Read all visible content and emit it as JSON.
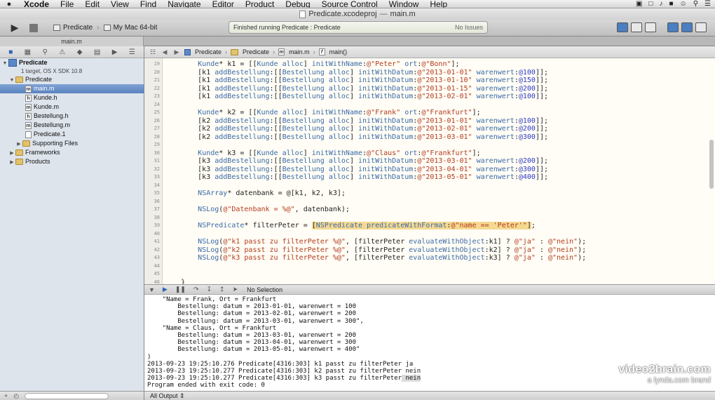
{
  "menubar": {
    "app": "Xcode",
    "items": [
      "File",
      "Edit",
      "View",
      "Find",
      "Navigate",
      "Editor",
      "Product",
      "Debug",
      "Source Control",
      "Window",
      "Help"
    ]
  },
  "window": {
    "title": "Predicate.xcodeproj",
    "separator": "—",
    "file": "main.m"
  },
  "toolbar": {
    "scheme": "Predicate",
    "destination": "My Mac 64-bit",
    "status_text": "Finished running Predicate : Predicate",
    "issues": "No Issues"
  },
  "tab": {
    "label": "main.m"
  },
  "jumpbar": {
    "crumbs": [
      "Predicate",
      "Predicate",
      "main.m",
      "main()"
    ]
  },
  "navigator": {
    "project": "Predicate",
    "project_sub": "1 target, OS X SDK 10.8",
    "items": [
      {
        "label": "Predicate",
        "type": "folder",
        "level": 1,
        "open": true
      },
      {
        "label": "main.m",
        "type": "file",
        "badge": "m",
        "level": 2,
        "selected": true
      },
      {
        "label": "Kunde.h",
        "type": "file",
        "badge": "h",
        "level": 2
      },
      {
        "label": "Kunde.m",
        "type": "file",
        "badge": "m",
        "level": 2
      },
      {
        "label": "Bestellung.h",
        "type": "file",
        "badge": "h",
        "level": 2
      },
      {
        "label": "Bestellung.m",
        "type": "file",
        "badge": "m",
        "level": 2
      },
      {
        "label": "Predicate.1",
        "type": "file",
        "badge": "",
        "level": 2
      },
      {
        "label": "Supporting Files",
        "type": "folder",
        "level": 2,
        "open": false
      },
      {
        "label": "Frameworks",
        "type": "folder",
        "level": 1,
        "open": false
      },
      {
        "label": "Products",
        "type": "folder",
        "level": 1,
        "open": false
      }
    ]
  },
  "editor": {
    "line_numbers": [
      "19",
      "20",
      "21",
      "22",
      "23",
      "24",
      "25",
      "26",
      "27",
      "28",
      "29",
      "30",
      "31",
      "32",
      "33",
      "34",
      "35",
      "36",
      "37",
      "38",
      "39",
      "40",
      "41",
      "42",
      "43",
      "44",
      "45",
      "46"
    ],
    "lines": [
      "        Kunde* k1 = [[Kunde alloc] initWithName:@\"Peter\" ort:@\"Bonn\"];",
      "        [k1 addBestellung:[[Bestellung alloc] initWithDatum:@\"2013-01-01\" warenwert:@100]];",
      "        [k1 addBestellung:[[Bestellung alloc] initWithDatum:@\"2013-01-10\" warenwert:@150]];",
      "        [k1 addBestellung:[[Bestellung alloc] initWithDatum:@\"2013-01-15\" warenwert:@200]];",
      "        [k1 addBestellung:[[Bestellung alloc] initWithDatum:@\"2013-02-01\" warenwert:@100]];",
      "",
      "        Kunde* k2 = [[Kunde alloc] initWithName:@\"Frank\" ort:@\"Frankfurt\"];",
      "        [k2 addBestellung:[[Bestellung alloc] initWithDatum:@\"2013-01-01\" warenwert:@100]];",
      "        [k2 addBestellung:[[Bestellung alloc] initWithDatum:@\"2013-02-01\" warenwert:@200]];",
      "        [k2 addBestellung:[[Bestellung alloc] initWithDatum:@\"2013-03-01\" warenwert:@300]];",
      "",
      "        Kunde* k3 = [[Kunde alloc] initWithName:@\"Claus\" ort:@\"Frankfurt\"];",
      "        [k3 addBestellung:[[Bestellung alloc] initWithDatum:@\"2013-03-01\" warenwert:@200]];",
      "        [k3 addBestellung:[[Bestellung alloc] initWithDatum:@\"2013-04-01\" warenwert:@300]];",
      "        [k3 addBestellung:[[Bestellung alloc] initWithDatum:@\"2013-05-01\" warenwert:@400]];",
      "",
      "        NSArray* datenbank = @[k1, k2, k3];",
      "",
      "        NSLog(@\"Datenbank = %@\", datenbank);",
      "",
      "        NSPredicate* filterPeter = [NSPredicate predicateWithFormat:@\"name == 'Peter'\"];",
      "",
      "        NSLog(@\"k1 passt zu filterPeter %@\", [filterPeter evaluateWithObject:k1] ? @\"ja\" : @\"nein\");",
      "        NSLog(@\"k2 passt zu filterPeter %@\", [filterPeter evaluateWithObject:k2] ? @\"ja\" : @\"nein\");",
      "        NSLog(@\"k3 passt zu filterPeter %@\", [filterPeter evaluateWithObject:k3] ? @\"ja\" : @\"nein\");",
      "",
      "",
      "    }"
    ]
  },
  "debugbar": {
    "selection": "No Selection"
  },
  "console": {
    "lines": [
      "    \"Name = Frank, Ort = Frankfurt",
      "        Bestellung: datum = 2013-01-01, warenwert = 100",
      "        Bestellung: datum = 2013-02-01, warenwert = 200",
      "        Bestellung: datum = 2013-03-01, warenwert = 300\",",
      "    \"Name = Claus, Ort = Frankfurt",
      "        Bestellung: datum = 2013-03-01, warenwert = 200",
      "        Bestellung: datum = 2013-04-01, warenwert = 300",
      "        Bestellung: datum = 2013-05-01, warenwert = 400\"",
      ")",
      "2013-09-23 19:25:10.276 Predicate[4316:303] k1 passt zu filterPeter ja",
      "2013-09-23 19:25:10.277 Predicate[4316:303] k2 passt zu filterPeter nein",
      "2013-09-23 19:25:10.277 Predicate[4316:303] k3 passt zu filterPeter nein",
      "Program ended with exit code: 0"
    ],
    "output_selector": "All Output ⇕"
  },
  "watermark": {
    "line1": "video2brain.com",
    "line2": "a lynda.com brand"
  }
}
